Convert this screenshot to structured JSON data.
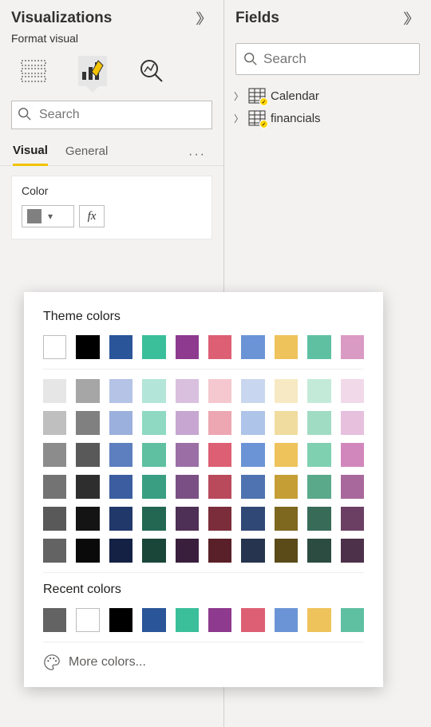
{
  "viz": {
    "title": "Visualizations",
    "subtitle": "Format visual",
    "search_placeholder": "Search",
    "tabs": {
      "visual": "Visual",
      "general": "General"
    },
    "card": {
      "label": "Color",
      "fx": "fx",
      "selected_color": "#808080"
    }
  },
  "fields": {
    "title": "Fields",
    "search_placeholder": "Search",
    "tables": [
      {
        "name": "Calendar"
      },
      {
        "name": "financials"
      }
    ]
  },
  "color_picker": {
    "theme_title": "Theme colors",
    "recent_title": "Recent colors",
    "more_colors": "More colors...",
    "theme_row": [
      "#ffffff",
      "#000000",
      "#2a5599",
      "#3bbf9b",
      "#8e3a8e",
      "#dd5f74",
      "#6b94d6",
      "#eec35b",
      "#5fc0a1",
      "#d99ac3"
    ],
    "shades": [
      [
        "#e6e6e6",
        "#a6a6a6",
        "#b5c3e6",
        "#b3e6d8",
        "#d9c0df",
        "#f4c8ce",
        "#c8d6ef",
        "#f7e9c3",
        "#c3ead9",
        "#f1d9ea"
      ],
      [
        "#bfbfbf",
        "#808080",
        "#9bb0dd",
        "#8fd9c3",
        "#c7a7d1",
        "#eda7b2",
        "#aec4e8",
        "#f1dca0",
        "#a0dcc3",
        "#e7c0de"
      ],
      [
        "#8c8c8c",
        "#595959",
        "#5d7fc0",
        "#5fc0a1",
        "#9b6fa6",
        "#dd5f74",
        "#6b94d6",
        "#eec35b",
        "#7fd0b1",
        "#d187bc"
      ],
      [
        "#737373",
        "#2e2e2e",
        "#3c5ea0",
        "#3a9e82",
        "#7a5084",
        "#b84a5c",
        "#4f73b0",
        "#c59f36",
        "#59a98a",
        "#a9689c"
      ],
      [
        "#595959",
        "#141414",
        "#21386b",
        "#236752",
        "#4e2f55",
        "#7c2d3c",
        "#2f4876",
        "#7e671f",
        "#386b58",
        "#6b3f63"
      ],
      [
        "#636363",
        "#0a0a0a",
        "#142145",
        "#1a463a",
        "#3a1f3d",
        "#5a2029",
        "#26344f",
        "#5a4b19",
        "#2c4c41",
        "#4d3049"
      ]
    ],
    "recent": [
      "#636363",
      "#ffffff",
      "#000000",
      "#2a5599",
      "#3bbf9b",
      "#8e3a8e",
      "#dd5f74",
      "#6b94d6",
      "#eec35b",
      "#5fc0a1"
    ]
  }
}
